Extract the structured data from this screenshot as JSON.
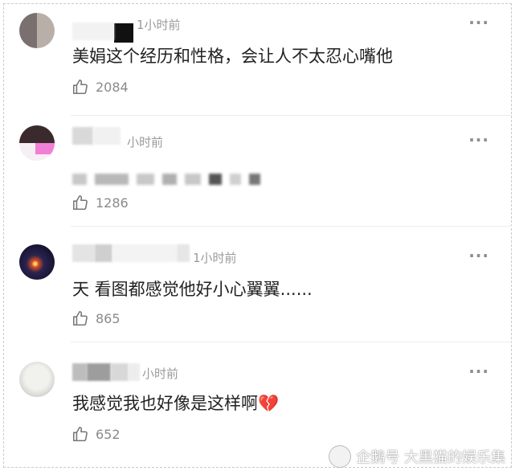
{
  "comments": [
    {
      "time": "1小时前",
      "text": "美娟这个经历和性格，会让人不太忍心嘴他",
      "likes": "2084"
    },
    {
      "time": "小时前",
      "text": "",
      "likes": "1286"
    },
    {
      "time": "1小时前",
      "text": "天 看图都感觉他好小心翼翼......",
      "likes": "865"
    },
    {
      "time": "小时前",
      "text": "我感觉我也好像是这样啊💔",
      "likes": "652"
    }
  ],
  "more_icon": "···",
  "like_icon": "thumbs-up-icon",
  "watermark": {
    "text": "企鹅号 大黑猫的娱乐集",
    "icon": "penguin-logo-icon"
  },
  "colors": {
    "text": "#222222",
    "meta": "#9a9a9a",
    "divider": "#ececec"
  }
}
